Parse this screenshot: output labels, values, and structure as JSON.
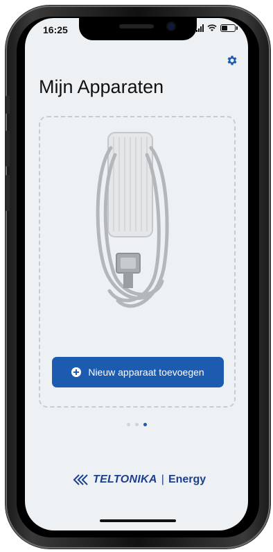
{
  "status_bar": {
    "time": "16:25"
  },
  "header": {
    "title": "Mijn Apparaten",
    "settings_icon": "gear-icon"
  },
  "device_card": {
    "image": "ev-charger-placeholder",
    "add_button": {
      "label": "Nieuw apparaat toevoegen",
      "icon": "plus-circle-icon"
    }
  },
  "pager": {
    "count": 3,
    "active_index": 2
  },
  "brand": {
    "name": "TELTONIKA",
    "separator": "|",
    "suffix": "Energy"
  },
  "colors": {
    "accent": "#1c5bb0",
    "background": "#eef1f4",
    "brand": "#1c3f8f"
  }
}
